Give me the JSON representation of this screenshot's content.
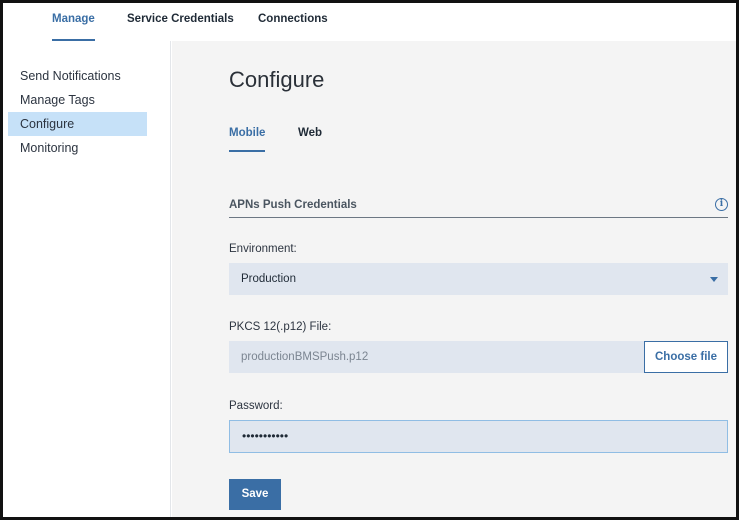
{
  "topnav": {
    "tabs": [
      {
        "label": "Manage",
        "active": true
      },
      {
        "label": "Service Credentials",
        "active": false
      },
      {
        "label": "Connections",
        "active": false
      }
    ]
  },
  "sidebar": {
    "items": [
      {
        "label": "Send Notifications",
        "active": false
      },
      {
        "label": "Manage Tags",
        "active": false
      },
      {
        "label": "Configure",
        "active": true
      },
      {
        "label": "Monitoring",
        "active": false
      }
    ]
  },
  "main": {
    "title": "Configure",
    "subtabs": [
      {
        "label": "Mobile",
        "active": true
      },
      {
        "label": "Web",
        "active": false
      }
    ],
    "section_title": "APNs Push Credentials",
    "info_icon_glyph": "i",
    "environment": {
      "label": "Environment:",
      "value": "Production"
    },
    "pkcs": {
      "label": "PKCS 12(.p12) File:",
      "value": "productionBMSPush.p12",
      "button_label": "Choose file"
    },
    "password": {
      "label": "Password:",
      "value": "•••••••••••"
    },
    "save_label": "Save"
  },
  "colors": {
    "accent": "#3a6ea5",
    "selected_bg": "#c6e1f8",
    "field_bg": "#e0e6ef",
    "main_bg": "#f4f4f4"
  }
}
